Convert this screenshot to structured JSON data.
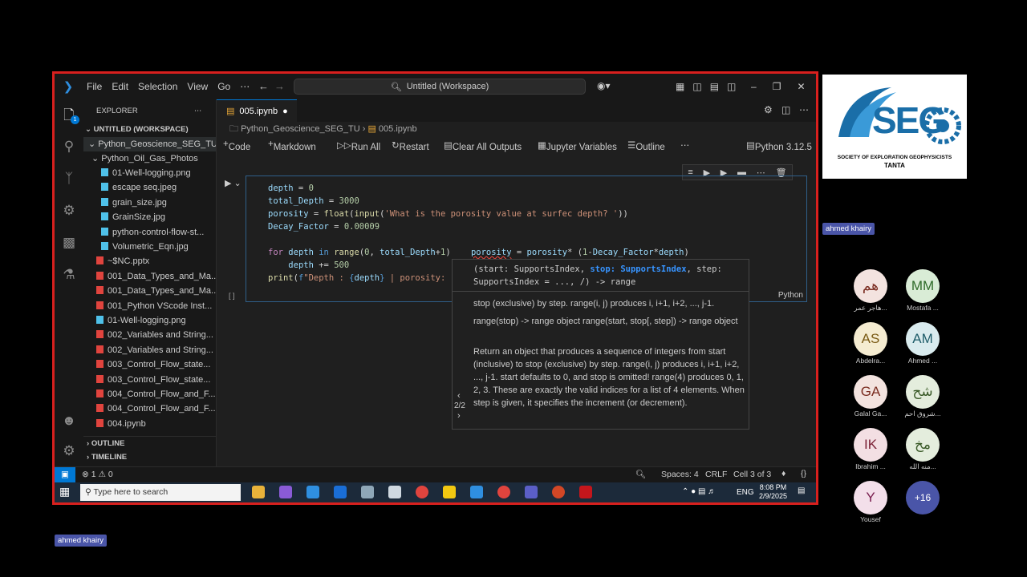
{
  "titlebar": {
    "menu": [
      "File",
      "Edit",
      "Selection",
      "View",
      "Go",
      "⋯"
    ],
    "search": "Untitled (Workspace)"
  },
  "sidebar": {
    "header": "EXPLORER",
    "workspace": "UNTITLED (WORKSPACE)",
    "folder": "Python_Geoscience_SEG_TU",
    "subfolder": "Python_Oil_Gas_Photos",
    "files": [
      {
        "name": "01-Well-logging.png",
        "indent": 2,
        "color": "#4fc1e9"
      },
      {
        "name": "escape seq.jpeg",
        "indent": 2,
        "color": "#4fc1e9"
      },
      {
        "name": "grain_size.jpg",
        "indent": 2,
        "color": "#4fc1e9"
      },
      {
        "name": "GrainSize.jpg",
        "indent": 2,
        "color": "#4fc1e9"
      },
      {
        "name": "python-control-flow-st...",
        "indent": 2,
        "color": "#4fc1e9"
      },
      {
        "name": "Volumetric_Eqn.jpg",
        "indent": 2,
        "color": "#4fc1e9"
      },
      {
        "name": "~$NC.pptx",
        "indent": 1,
        "color": "#e0443e"
      },
      {
        "name": "001_Data_Types_and_Ma...",
        "indent": 1,
        "color": "#e0443e"
      },
      {
        "name": "001_Data_Types_and_Ma...",
        "indent": 1,
        "color": "#e0443e"
      },
      {
        "name": "001_Python VScode Inst...",
        "indent": 1,
        "color": "#e0443e"
      },
      {
        "name": "01-Well-logging.png",
        "indent": 1,
        "color": "#4fc1e9"
      },
      {
        "name": "002_Variables and String...",
        "indent": 1,
        "color": "#e0443e"
      },
      {
        "name": "002_Variables and String...",
        "indent": 1,
        "color": "#e0443e"
      },
      {
        "name": "003_Control_Flow_state...",
        "indent": 1,
        "color": "#e0443e"
      },
      {
        "name": "003_Control_Flow_state...",
        "indent": 1,
        "color": "#e0443e"
      },
      {
        "name": "004_Control_Flow_and_F...",
        "indent": 1,
        "color": "#e0443e"
      },
      {
        "name": "004_Control_Flow_and_F...",
        "indent": 1,
        "color": "#e0443e"
      },
      {
        "name": "004.ipynb",
        "indent": 1,
        "color": "#e0443e"
      }
    ],
    "outline": "OUTLINE",
    "timeline": "TIMELINE"
  },
  "editor": {
    "tab": "005.ipynb",
    "breadcrumb_folder": "Python_Geoscience_SEG_TU",
    "breadcrumb_file": "005.ipynb",
    "toolbar": {
      "code": "Code",
      "markdown": "Markdown",
      "run_all": "Run All",
      "restart": "Restart",
      "clear": "Clear All Outputs",
      "variables": "Jupyter Variables",
      "outline": "Outline",
      "kernel": "Python 3.12.5"
    },
    "cell_lang": "Python",
    "exec_count": "[ ]"
  },
  "hover": {
    "signature_1": "(start: SupportsIndex, ",
    "signature_stop": "stop: SupportsIndex",
    "signature_2": ", step:",
    "signature_3": "SupportsIndex = ..., /) -> range",
    "line1": "stop (exclusive) by step. range(i, j) produces i, i+1, i+2, ..., j-1.",
    "line2": "range(stop) -> range object range(start, stop[, step]) -> range object",
    "line3": "Return an object that produces a sequence of integers from start (inclusive) to stop (exclusive) by step. range(i, j) produces i, i+1, i+2, ..., j-1. start defaults to 0, and stop is omitted! range(4) produces 0, 1, 2, 3. These are exactly the valid indices for a list of 4 elements. When step is given, it specifies the increment (or decrement).",
    "nav": "2/2"
  },
  "statusbar": {
    "errors": "1",
    "warnings": "0",
    "spaces": "Spaces: 4",
    "eol": "CRLF",
    "cell": "Cell 3 of 3"
  },
  "taskbar": {
    "search": "Type here to search",
    "lang": "ENG",
    "time": "8:08 PM",
    "date": "2/9/2025"
  },
  "meeting": {
    "presenter_tag": "ahmed khairy",
    "presenter_tag_bottom": "ahmed khairy",
    "logo_org": "SOCIETY OF EXPLORATION GEOPHYSICISTS",
    "logo_city": "TANTA",
    "logo_text": "SEG",
    "participants": [
      {
        "initials": "هم",
        "name": "هاجر عمر...",
        "bg": "#f3e3df",
        "fg": "#7a2c20"
      },
      {
        "initials": "MM",
        "name": "Mostafa ...",
        "bg": "#d9ecd6",
        "fg": "#2f6b2a"
      },
      {
        "initials": "AS",
        "name": "Abdelra...",
        "bg": "#f5ecd1",
        "fg": "#7a5a14"
      },
      {
        "initials": "AM",
        "name": "Ahmed ...",
        "bg": "#d9ebee",
        "fg": "#1f5d6a"
      },
      {
        "initials": "GA",
        "name": "Galal Ga...",
        "bg": "#f3e3df",
        "fg": "#7a2c20"
      },
      {
        "initials": "شح",
        "name": "شروق احم...",
        "bg": "#e4eddd",
        "fg": "#3a5a28"
      },
      {
        "initials": "IK",
        "name": "Ibrahim ...",
        "bg": "#f3dfe3",
        "fg": "#7a2035"
      },
      {
        "initials": "مخ",
        "name": "منه الله...",
        "bg": "#e4eddd",
        "fg": "#3a5a28"
      },
      {
        "initials": "Y",
        "name": "Yousef",
        "bg": "#f3dfea",
        "fg": "#7a2050"
      },
      {
        "initials": "+16",
        "name": "",
        "bg": "#4a55a8",
        "fg": "#ffffff"
      }
    ]
  }
}
